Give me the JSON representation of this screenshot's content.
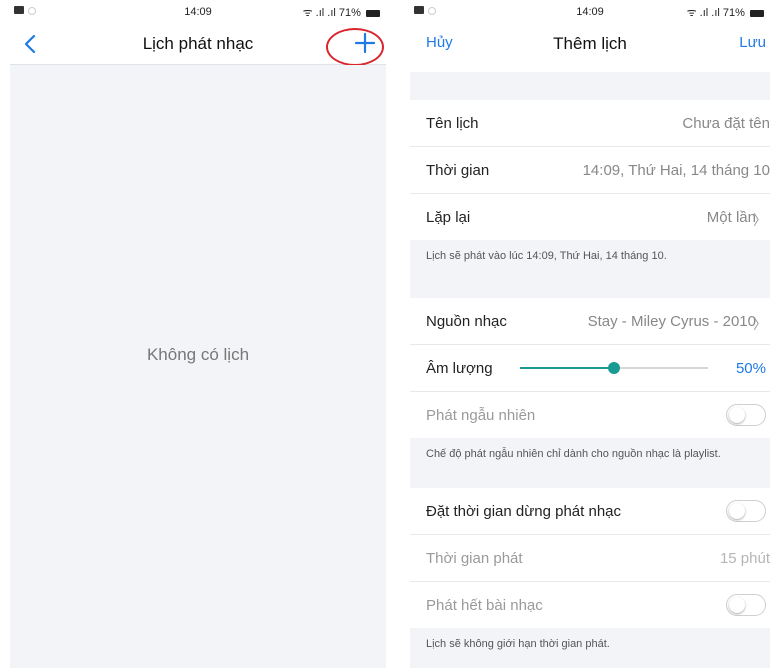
{
  "left": {
    "status": {
      "time": "14:09",
      "battery": "71%"
    },
    "nav": {
      "title": "Lịch phát nhạc"
    },
    "empty": "Không có lịch"
  },
  "right": {
    "status": {
      "time": "14:09",
      "battery": "71%"
    },
    "nav": {
      "cancel": "Hủy",
      "title": "Thêm lịch",
      "save": "Lưu"
    },
    "name_row": {
      "label": "Tên lịch",
      "value": "Chưa đặt tên"
    },
    "time_row": {
      "label": "Thời gian",
      "value": "14:09, Thứ Hai, 14 tháng 10"
    },
    "repeat_row": {
      "label": "Lặp lại",
      "value": "Một lần"
    },
    "schedule_note": "Lịch sẽ phát vào lúc 14:09, Thứ Hai, 14 tháng 10.",
    "source_row": {
      "label": "Nguồn nhạc",
      "value": "Stay - Miley Cyrus - 2010"
    },
    "volume_row": {
      "label": "Âm lượng",
      "value": "50%",
      "level": 0.5
    },
    "shuffle_row": {
      "label": "Phát ngẫu nhiên",
      "on": false
    },
    "shuffle_note": "Chế độ phát ngẫu nhiên chỉ dành cho nguồn nhạc là playlist.",
    "stop_timer_row": {
      "label": "Đặt thời gian dừng phát nhạc",
      "on": false
    },
    "play_time_row": {
      "label": "Thời gian phát",
      "value": "15 phút"
    },
    "play_full_row": {
      "label": "Phát hết bài nhạc",
      "on": false
    },
    "limit_note": "Lịch sẽ không giới hạn thời gian phát."
  },
  "colors": {
    "accent": "#1e7ae6",
    "slider": "#1a9a93",
    "highlight": "#d9262c",
    "background": "#f2f4f8"
  },
  "icons": {
    "back": "chevron-left-icon",
    "add": "plus-icon",
    "chevron": "chevron-right-icon",
    "wifi": "wifi-icon",
    "signal": "signal-icon",
    "battery": "battery-icon"
  }
}
